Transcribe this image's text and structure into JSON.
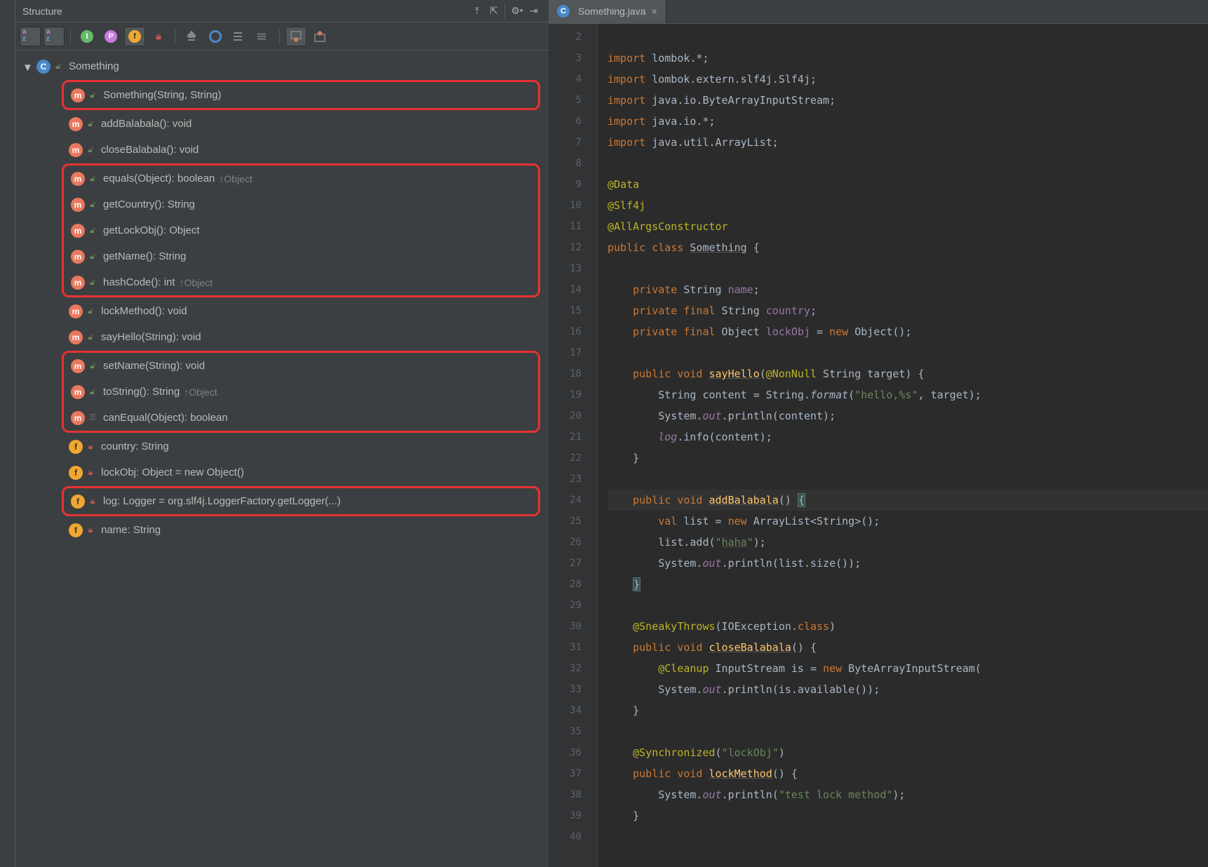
{
  "panel": {
    "title": "Structure"
  },
  "class_name": "Something",
  "tab": {
    "label": "Something.java"
  },
  "groups": [
    {
      "type": "plain",
      "items": [
        {
          "icon": "c",
          "vis": "open",
          "label": "Something",
          "root": true
        }
      ]
    },
    {
      "type": "box",
      "items": [
        {
          "icon": "m",
          "vis": "open",
          "label": "Something(String, String)"
        }
      ]
    },
    {
      "type": "plain",
      "items": [
        {
          "icon": "m",
          "vis": "open",
          "label": "addBalabala(): void"
        },
        {
          "icon": "m",
          "vis": "open",
          "label": "closeBalabala(): void"
        }
      ]
    },
    {
      "type": "box",
      "items": [
        {
          "icon": "m",
          "vis": "open",
          "label": "equals(Object): boolean",
          "override": "↑Object"
        },
        {
          "icon": "m",
          "vis": "open",
          "label": "getCountry(): String"
        },
        {
          "icon": "m",
          "vis": "open",
          "label": "getLockObj(): Object"
        },
        {
          "icon": "m",
          "vis": "open",
          "label": "getName(): String"
        },
        {
          "icon": "m",
          "vis": "open",
          "label": "hashCode(): int",
          "override": "↑Object"
        }
      ]
    },
    {
      "type": "plain",
      "items": [
        {
          "icon": "m",
          "vis": "open",
          "label": "lockMethod(): void"
        },
        {
          "icon": "m",
          "vis": "open",
          "label": "sayHello(String): void"
        }
      ]
    },
    {
      "type": "box",
      "items": [
        {
          "icon": "m",
          "vis": "open",
          "label": "setName(String): void"
        },
        {
          "icon": "m",
          "vis": "open",
          "label": "toString(): String",
          "override": "↑Object"
        },
        {
          "icon": "m",
          "vis": "key",
          "label": "canEqual(Object): boolean"
        }
      ]
    },
    {
      "type": "plain",
      "items": [
        {
          "icon": "fd",
          "vis": "lock",
          "label": "country: String"
        },
        {
          "icon": "fd",
          "vis": "lock",
          "label": "lockObj: Object = new Object()"
        }
      ]
    },
    {
      "type": "box",
      "items": [
        {
          "icon": "fd",
          "vis": "lock",
          "label": "log: Logger = org.slf4j.LoggerFactory.getLogger(...)"
        }
      ]
    },
    {
      "type": "plain",
      "items": [
        {
          "icon": "fd",
          "vis": "lock",
          "label": "name: String"
        }
      ]
    }
  ],
  "gutter_start": 2,
  "gutter_end": 40,
  "code_lines": [
    {
      "n": 2,
      "html": ""
    },
    {
      "n": 3,
      "html": "<span class='kw'>import</span> lombok.*;"
    },
    {
      "n": 4,
      "html": "<span class='kw'>import</span> lombok.extern.slf4j.Slf4j;"
    },
    {
      "n": 5,
      "html": "<span class='kw'>import</span> java.io.ByteArrayInputStream;"
    },
    {
      "n": 6,
      "html": "<span class='kw'>import</span> java.io.*;"
    },
    {
      "n": 7,
      "html": "<span class='kw'>import</span> java.util.ArrayList;"
    },
    {
      "n": 8,
      "html": ""
    },
    {
      "n": 9,
      "html": "<span class='ann'>@Data</span>"
    },
    {
      "n": 10,
      "html": "<span class='ann'>@Slf4j</span>"
    },
    {
      "n": 11,
      "html": "<span class='ann'>@AllArgsConstructor</span>"
    },
    {
      "n": 12,
      "html": "<span class='kw'>public class</span> <span class='under'>Something</span> {"
    },
    {
      "n": 13,
      "html": ""
    },
    {
      "n": 14,
      "html": "    <span class='kw'>private</span> String <span class='fld'>name</span>;"
    },
    {
      "n": 15,
      "html": "    <span class='kw'>private final</span> String <span class='fld'>country</span>;"
    },
    {
      "n": 16,
      "html": "    <span class='kw'>private final</span> Object <span class='fld'>lockObj</span> = <span class='kw'>new</span> Object();"
    },
    {
      "n": 17,
      "html": ""
    },
    {
      "n": 18,
      "html": "    <span class='kw'>public void</span> <span class='fn under'>sayHello</span>(<span class='ann'>@NonNull</span> String target) {"
    },
    {
      "n": 19,
      "html": "        String content = String.<span class='it'>format</span>(<span class='str'>\"hello,%s\"</span>, target);"
    },
    {
      "n": 20,
      "html": "        System.<span class='fld it'>out</span>.println(content);"
    },
    {
      "n": 21,
      "html": "        <span class='fld it'>log</span>.info(content);"
    },
    {
      "n": 22,
      "html": "    }"
    },
    {
      "n": 23,
      "html": ""
    },
    {
      "n": 24,
      "html": "    <span class='kw'>public void</span> <span class='fn under'>addBalabala</span>() <span class='brace-hl'>{</span>",
      "cur": true
    },
    {
      "n": 25,
      "html": "        <span class='kw'>val</span> list = <span class='kw'>new</span> ArrayList&lt;String&gt;();"
    },
    {
      "n": 26,
      "html": "        list.add(<span class='str'>\"<span class='under'>haha</span>\"</span>);"
    },
    {
      "n": 27,
      "html": "        System.<span class='fld it'>out</span>.println(list.size());"
    },
    {
      "n": 28,
      "html": "    <span class='brace-hl'>}</span>"
    },
    {
      "n": 29,
      "html": ""
    },
    {
      "n": 30,
      "html": "    <span class='ann'>@SneakyThrows</span>(IOException.<span class='kw'>class</span>)"
    },
    {
      "n": 31,
      "html": "    <span class='kw'>public void</span> <span class='fn under'>closeBalabala</span>() {"
    },
    {
      "n": 32,
      "html": "        <span class='ann'>@Cleanup</span> InputStream is = <span class='kw'>new</span> ByteArrayInputStream("
    },
    {
      "n": 33,
      "html": "        System.<span class='fld it'>out</span>.println(is.available());"
    },
    {
      "n": 34,
      "html": "    }"
    },
    {
      "n": 35,
      "html": ""
    },
    {
      "n": 36,
      "html": "    <span class='ann'>@Synchronized</span>(<span class='str'>\"lockObj\"</span>)"
    },
    {
      "n": 37,
      "html": "    <span class='kw'>public void</span> <span class='fn under'>lockMethod</span>() {"
    },
    {
      "n": 38,
      "html": "        System.<span class='fld it'>out</span>.println(<span class='str'>\"test lock method\"</span>);"
    },
    {
      "n": 39,
      "html": "    }"
    },
    {
      "n": 40,
      "html": ""
    }
  ]
}
